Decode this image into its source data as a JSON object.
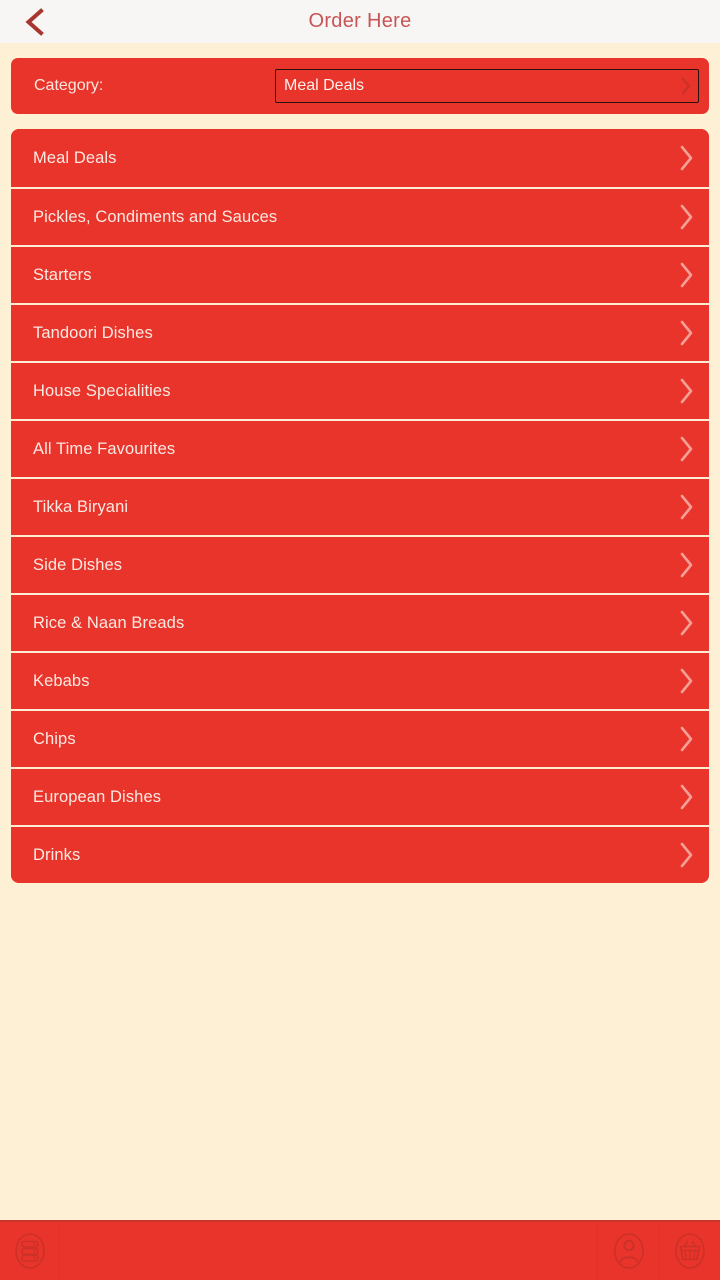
{
  "header": {
    "title": "Order Here",
    "back_icon": "chevron-left-icon"
  },
  "category": {
    "label": "Category:",
    "selected": "Meal Deals",
    "placeholder": "Meal Deals",
    "chevron_icon": "chevron-right-icon",
    "options": [
      "Meal Deals",
      "Pickles, Condiments and Sauces",
      "Starters",
      "Tandoori Dishes",
      "House Specialities",
      "All Time Favourites",
      "Tikka Biryani",
      "Side Dishes",
      "Rice & Naan Breads",
      "Kebabs",
      "Chips",
      "European Dishes",
      "Drinks"
    ]
  },
  "list": {
    "chevron_icon": "chevron-right-icon",
    "items": [
      {
        "label": "Meal Deals"
      },
      {
        "label": "Pickles, Condiments and Sauces"
      },
      {
        "label": "Starters"
      },
      {
        "label": "Tandoori Dishes"
      },
      {
        "label": "House Specialities"
      },
      {
        "label": "All Time Favourites"
      },
      {
        "label": "Tikka Biryani"
      },
      {
        "label": "Side Dishes"
      },
      {
        "label": "Rice & Naan Breads"
      },
      {
        "label": "Kebabs"
      },
      {
        "label": "Chips"
      },
      {
        "label": "European Dishes"
      },
      {
        "label": "Drinks"
      }
    ]
  },
  "bottom_bar": {
    "menu_icon": "menu-list-icon",
    "account_icon": "person-icon",
    "basket_icon": "shopping-basket-icon"
  },
  "colors": {
    "background": "#fdf0d5",
    "header_background": "#f7f6f5",
    "accent_red": "#e8342a",
    "title_red": "#c75555",
    "back_arrow_red": "#a9352f",
    "row_text": "#fbe9e2",
    "separator": "#fbeed5"
  }
}
